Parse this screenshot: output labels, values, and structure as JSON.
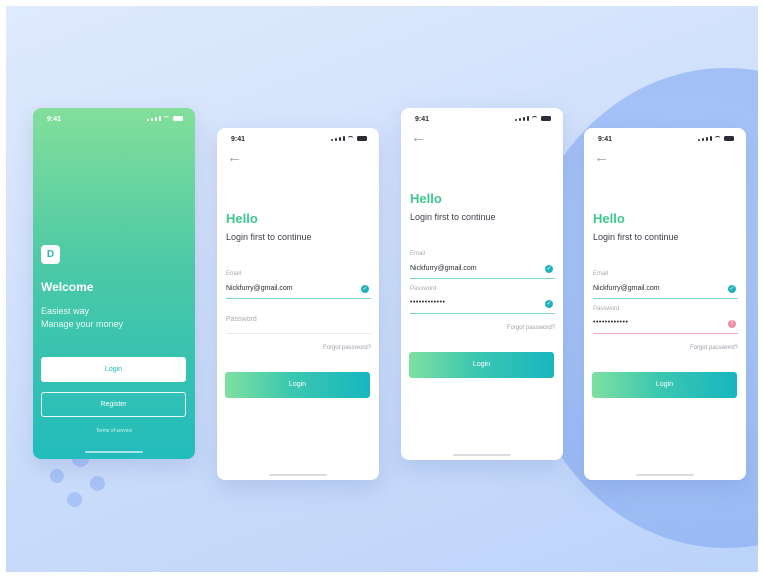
{
  "status_bar": {
    "time": "9:41"
  },
  "welcome_screen": {
    "logo_letter": "D",
    "title": "Welcome",
    "tagline_line1": "Easiest way",
    "tagline_line2": "Manage your money",
    "login_button": "Login",
    "register_button": "Register",
    "terms_link": "Terms of service"
  },
  "login_screen": {
    "heading": "Hello",
    "subtitle": "Login first to continue",
    "email_label": "Email",
    "password_label": "Password",
    "email_placeholder": "Password",
    "forgot_link": "Forgot password?",
    "login_button": "Login"
  },
  "login_empty": {
    "email_value": "Nickfurry@gmail.com",
    "password_placeholder": "Password"
  },
  "login_valid": {
    "email_value": "Nickfurry@gmail.com",
    "password_value": "••••••••••••"
  },
  "login_error": {
    "email_value": "Nickfurry@gmail.com",
    "password_value": "••••••••••••"
  },
  "colors": {
    "accent_green": "#3ec88f",
    "accent_teal": "#17b6c0",
    "error_pink": "#f08aa0"
  }
}
